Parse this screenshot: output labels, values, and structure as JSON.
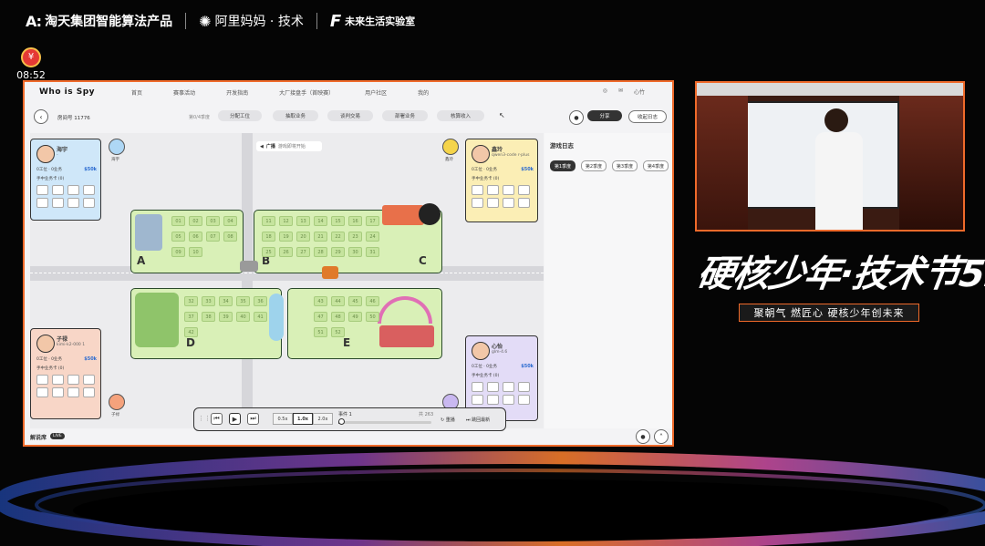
{
  "header": {
    "logo1": "淘天集团智能算法产品",
    "logo2": "阿里妈妈 · 技术",
    "logo3": "未来生活实验室",
    "clock": "08:52"
  },
  "app": {
    "brand": "Who is Spy",
    "nav": [
      "首页",
      "赛事活动",
      "开发指南",
      "大厂接盘手（首映赛）",
      "用户社区",
      "我的"
    ],
    "nav_user": "心竹",
    "room": "房间号 11776",
    "round_label": "第0/4季度",
    "actions": [
      "分配工位",
      "抽取业务",
      "谈判交易",
      "部署业务",
      "核算收入"
    ],
    "share": "分享",
    "collapse_log": "收起日志",
    "broadcast": "广播",
    "broadcast_text": "游戏即将开始",
    "log_title": "游戏日志",
    "quarters": [
      "第1季度",
      "第2季度",
      "第3季度",
      "第4季度"
    ],
    "commentary": "解说席",
    "live": "LIVE"
  },
  "players": [
    {
      "name": "海宇",
      "model": "-",
      "stats": "0工位 · 0业务",
      "money": "$50k",
      "card": "手中业务卡 (0)",
      "color": "#cfe7f9"
    },
    {
      "name": "鑫玲",
      "model": "qwen3-code r-plus",
      "stats": "0工位 · 0业务",
      "money": "$50k",
      "card": "手中业务卡 (0)",
      "color": "#fbeeb5"
    },
    {
      "name": "子禄",
      "model": "kimi-k2-000 1",
      "stats": "0工位 · 0业务",
      "money": "$50k",
      "card": "手中业务卡 (0)",
      "color": "#f8d6c7"
    },
    {
      "name": "心怡",
      "model": "glm-4.6",
      "stats": "0工位 · 0业务",
      "money": "$50k",
      "card": "手中业务卡 (0)",
      "color": "#e3dcf7"
    }
  ],
  "tokens": [
    {
      "label": "海宇"
    },
    {
      "label": "鑫玲"
    },
    {
      "label": "子禄"
    },
    {
      "label": "心怡"
    }
  ],
  "districts": {
    "A": [
      "01",
      "02",
      "03",
      "04",
      "05",
      "06",
      "07",
      "08",
      "09",
      "10"
    ],
    "B": [
      "11",
      "12",
      "13",
      "14",
      "15",
      "16",
      "17",
      "18",
      "19",
      "20",
      "21"
    ],
    "C": [
      "22",
      "23",
      "24",
      "25",
      "26",
      "27",
      "28",
      "29",
      "30",
      "31"
    ],
    "D": [
      "32",
      "33",
      "34",
      "35",
      "36",
      "37",
      "38",
      "39",
      "40",
      "41",
      "42"
    ],
    "E": [
      "43",
      "44",
      "45",
      "46",
      "47",
      "48",
      "49",
      "50",
      "51",
      "52"
    ]
  },
  "playback": {
    "speeds": [
      "0.5x",
      "1.0x",
      "2.0x"
    ],
    "active_speed": "1.0x",
    "event": "事件 1",
    "total": "共 263",
    "reset": "重播",
    "skip": "跳回最新",
    "progress": 0.01
  },
  "event_title": "硬核少年·技术节5.0",
  "slogan": "聚朝气 燃匠心 硬核少年创未来",
  "colors": {
    "accent": "#ef6a2a",
    "board": "#d9f0b7"
  }
}
